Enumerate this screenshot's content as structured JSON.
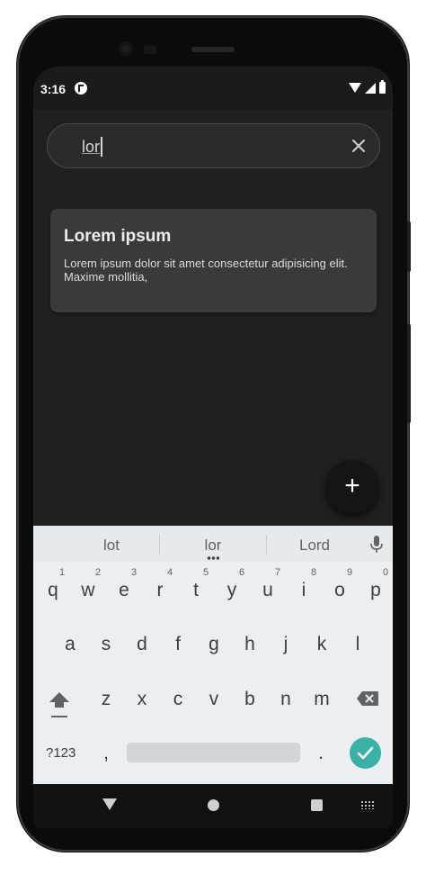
{
  "status_bar": {
    "time": "3:16"
  },
  "search": {
    "query_underlined": "lor",
    "clear_icon": "close-icon"
  },
  "card": {
    "title": "Lorem ipsum",
    "body": "Lorem ipsum dolor sit amet consectetur adipisicing elit. Maxime mollitia,"
  },
  "fab": {
    "label": "+"
  },
  "keyboard": {
    "suggestions": [
      "lot",
      "lor",
      "Lord"
    ],
    "row1": [
      "q",
      "w",
      "e",
      "r",
      "t",
      "y",
      "u",
      "i",
      "o",
      "p"
    ],
    "row1_hints": [
      "1",
      "2",
      "3",
      "4",
      "5",
      "6",
      "7",
      "8",
      "9",
      "0"
    ],
    "row2": [
      "a",
      "s",
      "d",
      "f",
      "g",
      "h",
      "j",
      "k",
      "l"
    ],
    "row3": [
      "z",
      "x",
      "c",
      "v",
      "b",
      "n",
      "m"
    ],
    "symbols_key": "?123",
    "comma_key": ",",
    "period_key": ".",
    "accent_color": "#3bb0a6"
  },
  "colors": {
    "background": "#202020",
    "card": "#3a3a3a",
    "fab": "#151515"
  }
}
